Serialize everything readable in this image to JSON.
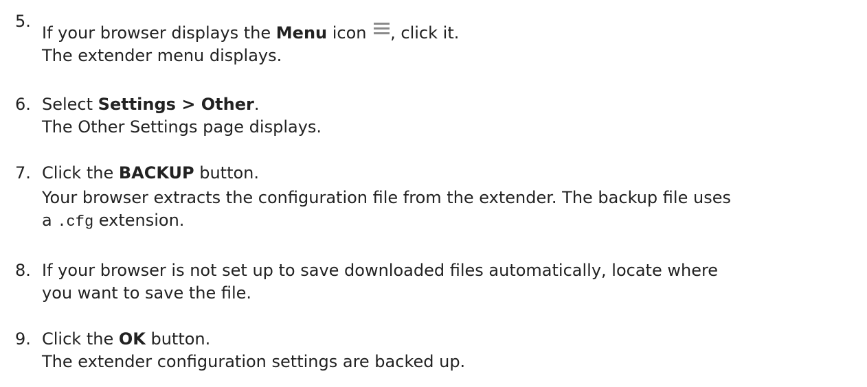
{
  "steps": [
    {
      "number": "5.",
      "lines": [
        {
          "pre": "If your browser displays the ",
          "bold": "Menu",
          "post": " icon ",
          "icon": "menu-icon",
          "after_icon": ", click it."
        },
        {
          "text": "The extender menu displays."
        }
      ]
    },
    {
      "number": "6.",
      "lines": [
        {
          "pre": "Select ",
          "bold": "Settings > Other",
          "post": "."
        },
        {
          "text": "The Other Settings page displays."
        }
      ]
    },
    {
      "number": "7.",
      "lines": [
        {
          "pre": "Click the ",
          "bold": "BACKUP",
          "post": " button."
        },
        {
          "text": "Your browser extracts the configuration file from the extender. The backup file uses"
        },
        {
          "pre": "a ",
          "mono": ".cfg",
          "post": " extension."
        }
      ]
    },
    {
      "number": "8.",
      "lines": [
        {
          "text": "If your browser is not set up to save downloaded files automatically, locate where"
        },
        {
          "text": "you want to save the file."
        }
      ]
    },
    {
      "number": "9.",
      "lines": [
        {
          "pre": "Click the ",
          "bold": "OK",
          "post": " button."
        },
        {
          "text": "The extender configuration settings are backed up."
        }
      ]
    }
  ],
  "icon_color": "#8a8a8a"
}
